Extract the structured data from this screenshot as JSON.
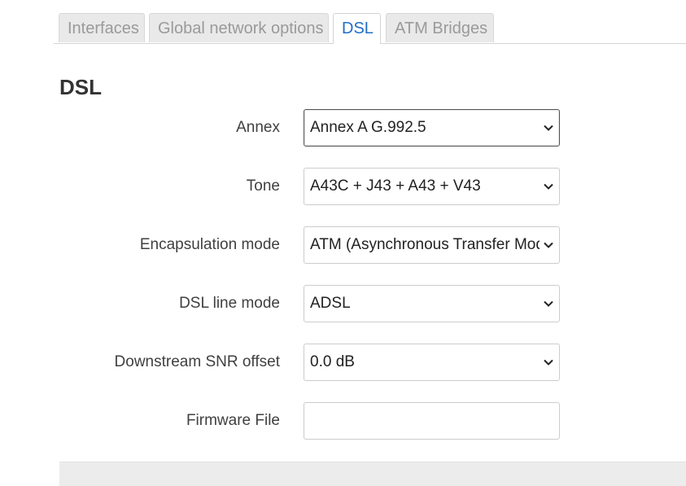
{
  "tabs": [
    {
      "label": "Interfaces",
      "active": false
    },
    {
      "label": "Global network options",
      "active": false
    },
    {
      "label": "DSL",
      "active": true
    },
    {
      "label": "ATM Bridges",
      "active": false
    }
  ],
  "section": {
    "title": "DSL"
  },
  "fields": {
    "annex": {
      "label": "Annex",
      "value": "Annex A G.992.5"
    },
    "tone": {
      "label": "Tone",
      "value": "A43C + J43 + A43 + V43"
    },
    "encapsulation": {
      "label": "Encapsulation mode",
      "value": "ATM (Asynchronous Transfer Mode)"
    },
    "line_mode": {
      "label": "DSL line mode",
      "value": "ADSL"
    },
    "snr_offset": {
      "label": "Downstream SNR offset",
      "value": "0.0 dB"
    },
    "firmware": {
      "label": "Firmware File",
      "value": "",
      "placeholder": ""
    }
  },
  "icons": {
    "dropdown": "chevron-down-icon"
  },
  "colors": {
    "active_tab_text": "#1f6fc5",
    "inactive_tab_bg": "#e9e9e9",
    "inactive_tab_text": "#9a9a9a"
  }
}
